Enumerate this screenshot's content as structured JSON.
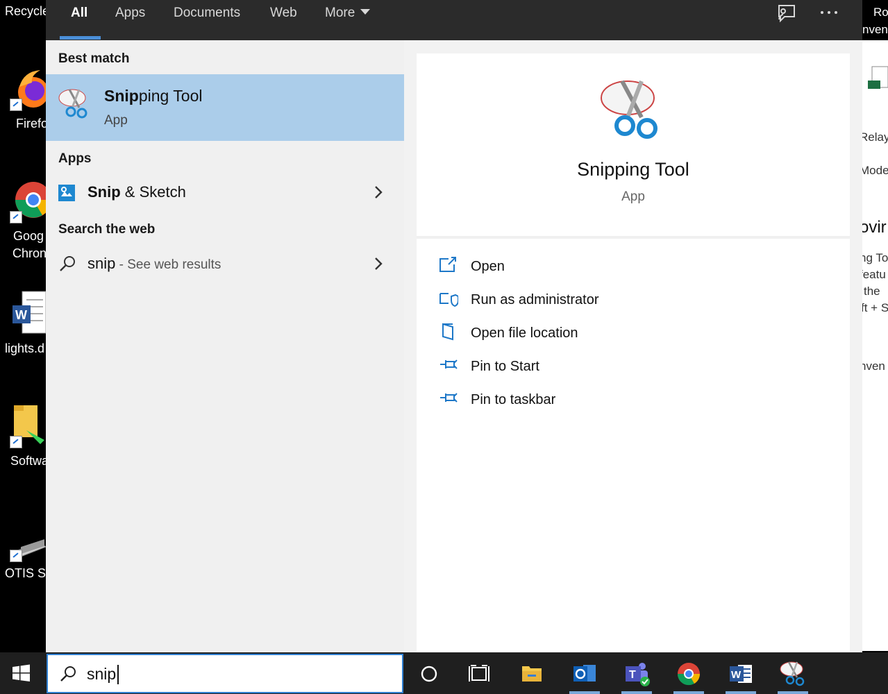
{
  "desktop": {
    "icons": [
      {
        "label": "Recycle",
        "top": 0
      },
      {
        "label": "Firefo"
      },
      {
        "label": "Goog"
      },
      {
        "label": "Chron"
      },
      {
        "label": "lights.d"
      },
      {
        "label": "Softwa"
      },
      {
        "label": "OTIS Sh"
      }
    ],
    "right_texts": [
      "Ro",
      "nven",
      "Relay",
      "Mode",
      "ovir",
      "ng To",
      "featu",
      "the",
      "ft + S",
      "nven"
    ]
  },
  "tabs": [
    {
      "label": "All"
    },
    {
      "label": "Apps"
    },
    {
      "label": "Documents"
    },
    {
      "label": "Web"
    },
    {
      "label": "More"
    }
  ],
  "top_icons": {
    "feedback": "feedback-icon",
    "more": "more-options-icon"
  },
  "results": {
    "best_match_header": "Best match",
    "best_match": {
      "title_bold": "Snip",
      "title_rest": "ping Tool",
      "subtitle": "App"
    },
    "apps_header": "Apps",
    "apps": [
      {
        "bold": "Snip",
        "rest": " & Sketch"
      }
    ],
    "web_header": "Search the web",
    "web": {
      "query": "snip",
      "suffix": " - See web results"
    }
  },
  "preview": {
    "title": "Snipping Tool",
    "subtitle": "App",
    "actions": [
      {
        "label": "Open",
        "icon": "open-icon"
      },
      {
        "label": "Run as administrator",
        "icon": "shield-icon"
      },
      {
        "label": "Open file location",
        "icon": "file-location-icon"
      },
      {
        "label": "Pin to Start",
        "icon": "pin-icon"
      },
      {
        "label": "Pin to taskbar",
        "icon": "pin-icon"
      }
    ]
  },
  "search": {
    "value": "snip"
  },
  "colors": {
    "accent": "#2f7fd1",
    "selection": "#abcdea",
    "tabbar": "#2b2b2b",
    "taskbar": "#1f1f1f"
  }
}
